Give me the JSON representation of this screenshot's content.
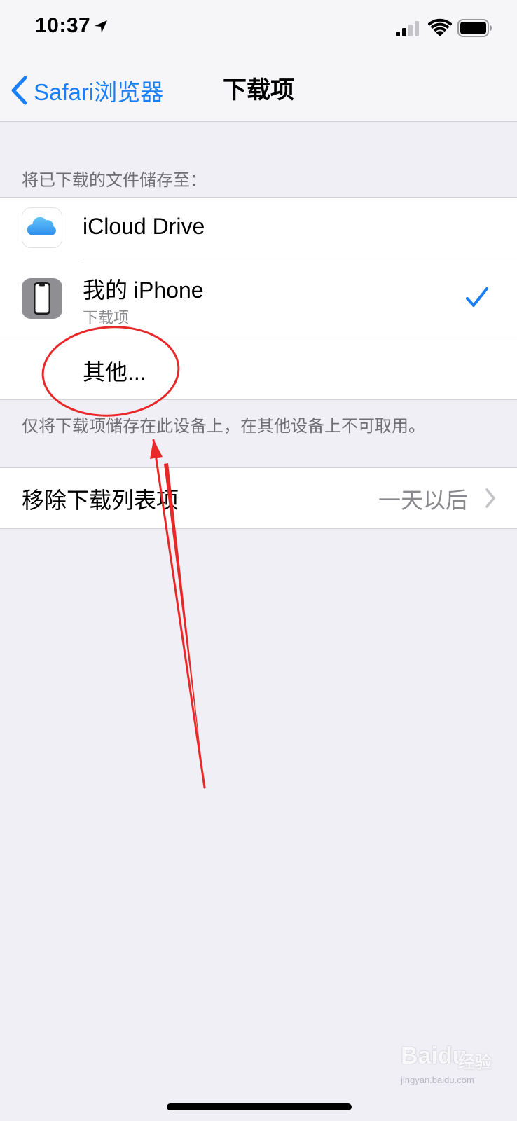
{
  "status_bar": {
    "time": "10:37",
    "icons": [
      "location-arrow-icon",
      "cellular-signal-icon",
      "wifi-icon",
      "battery-icon"
    ]
  },
  "nav": {
    "back_label": "Safari浏览器",
    "title": "下载项",
    "accent_color": "#1a7ef6"
  },
  "storage_section": {
    "header": "将已下载的文件储存至：",
    "options": [
      {
        "label": "iCloud Drive",
        "icon": "icloud-icon",
        "selected": false
      },
      {
        "label": "我的 iPhone",
        "sublabel": "下载项",
        "icon": "iphone-icon",
        "selected": true
      },
      {
        "label": "其他..."
      }
    ],
    "footer": "仅将下载项储存在此设备上，在其他设备上不可取用。"
  },
  "remove_section": {
    "label": "移除下载列表项",
    "value": "一天以后"
  },
  "annotation": {
    "color": "#e8292a",
    "shapes": [
      "ellipse-around-other",
      "arrow-pointing-up"
    ]
  },
  "watermark": {
    "brand": "Baidu",
    "brand_suffix": "经验",
    "url": "jingyan.baidu.com"
  }
}
